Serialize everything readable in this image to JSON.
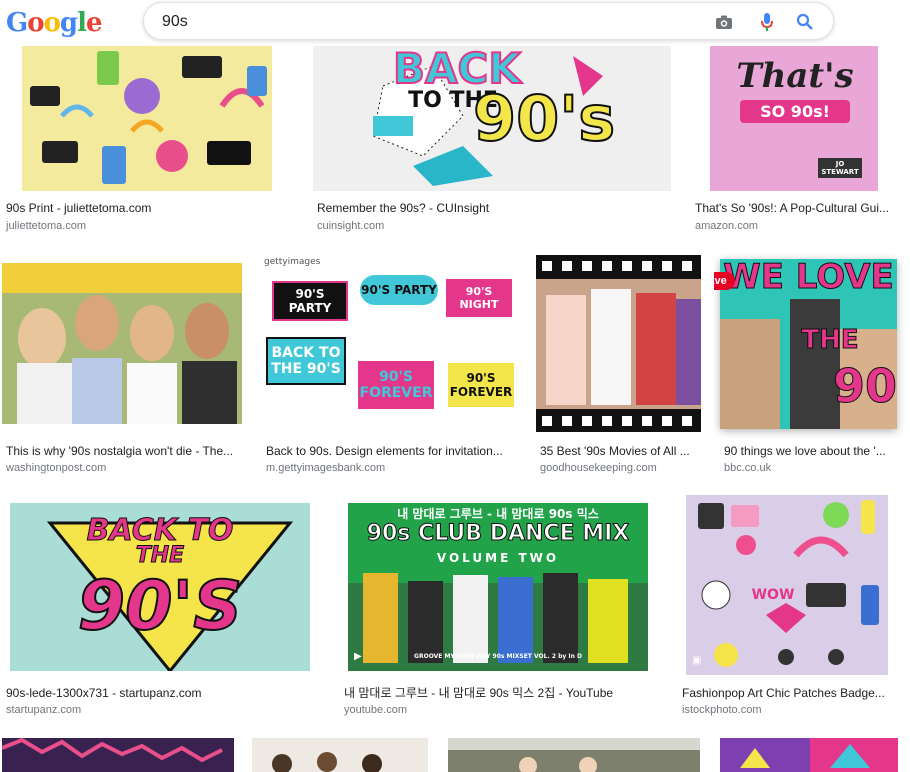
{
  "header": {
    "logo_letters": [
      "G",
      "o",
      "o",
      "g",
      "l",
      "e"
    ],
    "search_value": "90s"
  },
  "results": [
    {
      "caption": "90s Print - juliettetoma.com",
      "domain": "juliettetoma.com"
    },
    {
      "caption": "Remember the 90s? - CUInsight",
      "domain": "cuinsight.com",
      "thumb_text": [
        "BACK",
        "TO THE",
        "90's"
      ]
    },
    {
      "caption": "That's So '90s!: A Pop-Cultural Gui...",
      "domain": "amazon.com",
      "thumb_text": [
        "That's",
        "SO 90s!",
        "JO STEWART"
      ]
    },
    {
      "caption": "This is why '90s nostalgia won't die - The...",
      "domain": "washingtonpost.com"
    },
    {
      "caption": "Back to 90s. Design elements for invitation...",
      "domain": "m.gettyimagesbank.com",
      "thumb_text": [
        "gettyimages",
        "90'S PARTY",
        "90'S PARTY",
        "90'S NIGHT",
        "BACK TO THE 90'S",
        "90'S FOREVER",
        "90'S FOREVER"
      ]
    },
    {
      "caption": "35 Best '90s Movies of All ...",
      "domain": "goodhousekeeping.com"
    },
    {
      "caption": "90 things we love about the '...",
      "domain": "bbc.co.uk",
      "save_label": "Save",
      "thumb_text": [
        "WE LOVE",
        "THE",
        "90"
      ]
    },
    {
      "caption": "90s-lede-1300x731 - startupanz.com",
      "domain": "startupanz.com",
      "thumb_text": [
        "BACK TO",
        "THE",
        "90'S"
      ]
    },
    {
      "caption": "내 맘대로 그루브 - 내 맘대로 90s 믹스 2집 - YouTube",
      "domain": "youtube.com",
      "thumb_text": [
        "내 맘대로 그루브 - 내 맘대로 90s 믹스",
        "90s CLUB DANCE MIX",
        "VOLUME TWO",
        "GROOVE MY OWN WAY 90s MIXSET VOL. 2 by In D"
      ]
    },
    {
      "caption": "Fashionpop Art Chic Patches Badge...",
      "domain": "istockphoto.com",
      "thumb_text": [
        "WOW"
      ]
    }
  ],
  "colors": {
    "accent_blue": "#4285f4",
    "mic_red": "#ea4335",
    "caption_text": "#202124",
    "domain_text": "#70757a",
    "pinterest_red": "#e60023"
  },
  "icons": [
    "camera-icon",
    "microphone-icon",
    "search-icon",
    "pin-icon",
    "play-icon",
    "image-icon"
  ]
}
